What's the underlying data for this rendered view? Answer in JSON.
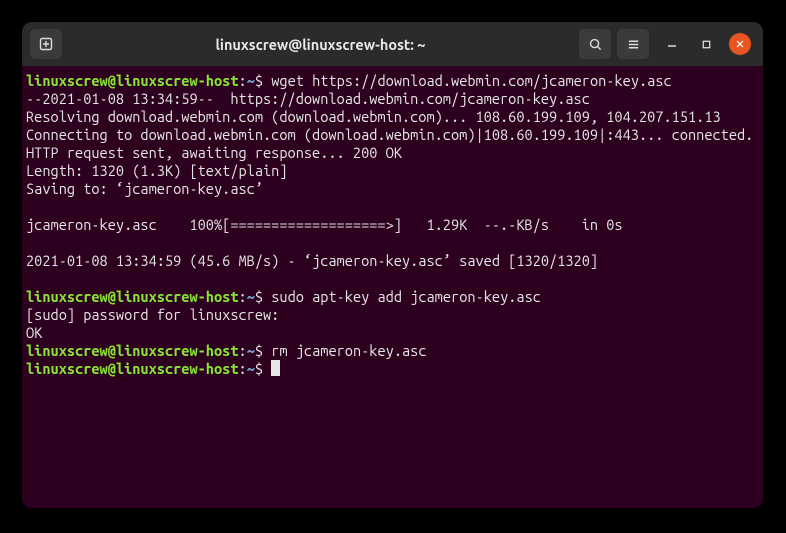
{
  "titlebar": {
    "title": "linuxscrew@linuxscrew-host: ~"
  },
  "prompt": {
    "userhost": "linuxscrew@linuxscrew-host",
    "sep": ":",
    "path": "~",
    "symbol": "$"
  },
  "lines": {
    "cmd1": " wget https://download.webmin.com/jcameron-key.asc",
    "out1a": "--2021-01-08 13:34:59--  https://download.webmin.com/jcameron-key.asc",
    "out1b": "Resolving download.webmin.com (download.webmin.com)... 108.60.199.109, 104.207.151.13",
    "out1c": "Connecting to download.webmin.com (download.webmin.com)|108.60.199.109|:443... connected.",
    "out1d": "HTTP request sent, awaiting response... 200 OK",
    "out1e": "Length: 1320 (1.3K) [text/plain]",
    "out1f": "Saving to: ‘jcameron-key.asc’",
    "blank1": "",
    "out1g": "jcameron-key.asc    100%[===================>]   1.29K  --.-KB/s    in 0s",
    "blank2": "",
    "out1h": "2021-01-08 13:34:59 (45.6 MB/s) - ‘jcameron-key.asc’ saved [1320/1320]",
    "blank3": "",
    "cmd2": " sudo apt-key add jcameron-key.asc",
    "out2a": "[sudo] password for linuxscrew:",
    "out2b": "OK",
    "cmd3": " rm jcameron-key.asc",
    "cmd4": " "
  }
}
